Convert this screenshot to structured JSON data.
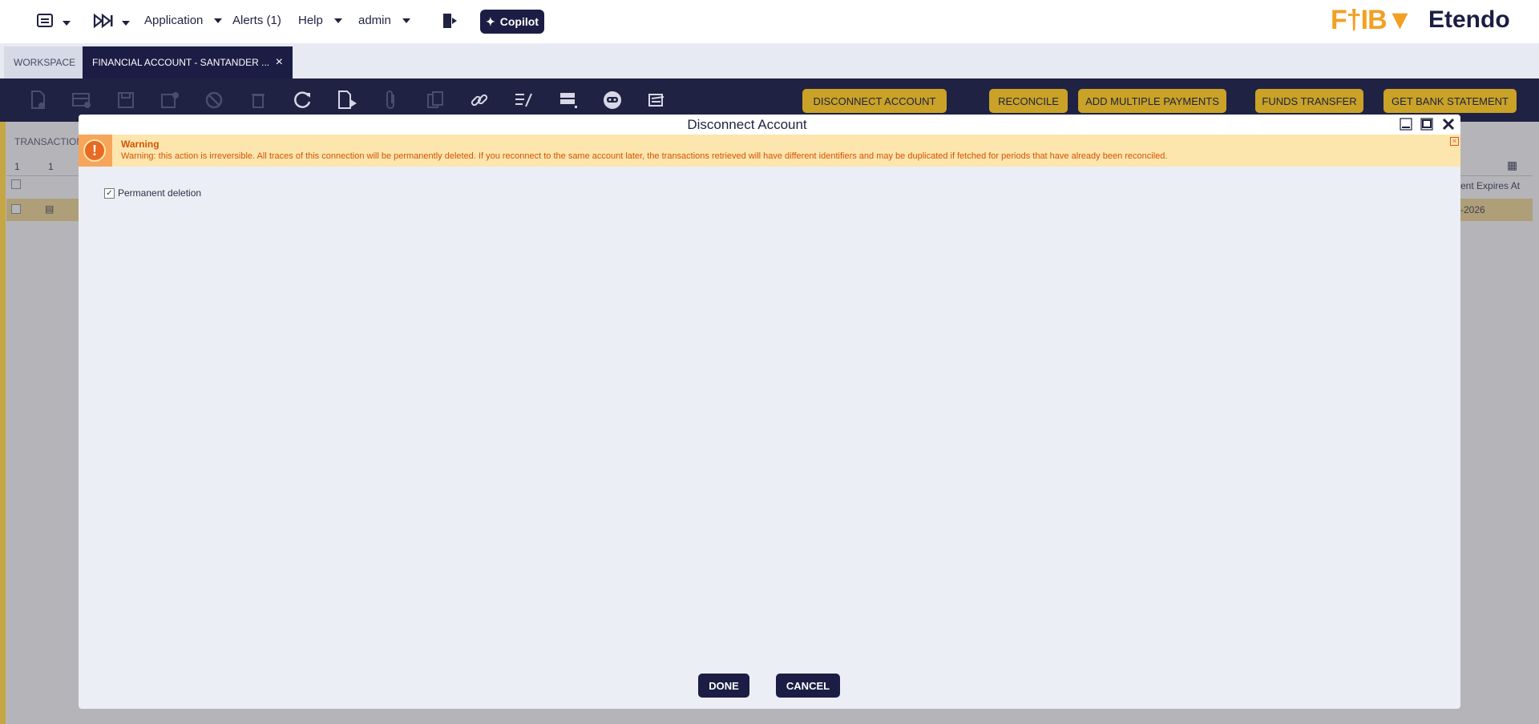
{
  "topbar": {
    "application_label": "Application",
    "alerts_label": "Alerts (1)",
    "help_label": "Help",
    "user_label": "admin",
    "copilot_label": "Copilot",
    "logo_secondary": "F†IB▼",
    "logo_main": "Etendo"
  },
  "tabs": {
    "workspace": "WORKSPACE",
    "financial": "FINANCIAL ACCOUNT - SANTANDER ...",
    "close_glyph": "×"
  },
  "toolbar": {
    "disconnect": "DISCONNECT ACCOUNT",
    "reconcile": "RECONCILE",
    "add_multiple_payments": "ADD MULTIPLE PAYMENTS",
    "funds_transfer": "FUNDS TRANSFER",
    "get_bank_statement": "GET BANK STATEMENT"
  },
  "background": {
    "subtab_label": "TRANSACTION",
    "row_count_left": "1",
    "row_count_right": "1",
    "column_partial": "ent Expires At",
    "cell_partial": "-2026"
  },
  "dialog": {
    "title": "Disconnect Account",
    "warning_title": "Warning",
    "warning_text": "Warning: this action is irreversible. All traces of this connection will be permanently deleted. If you reconnect to the same account later, the transactions retrieved will have different identifiers and may be duplicated if fetched for periods that have already been reconciled.",
    "checkbox_label": "Permanent deletion",
    "checkbox_checked": true,
    "done_label": "DONE",
    "cancel_label": "CANCEL"
  },
  "colors": {
    "navy": "#1b1d44",
    "gold": "#c9a227",
    "warning_bg": "#fde5ae",
    "warning_text": "#d35400"
  }
}
